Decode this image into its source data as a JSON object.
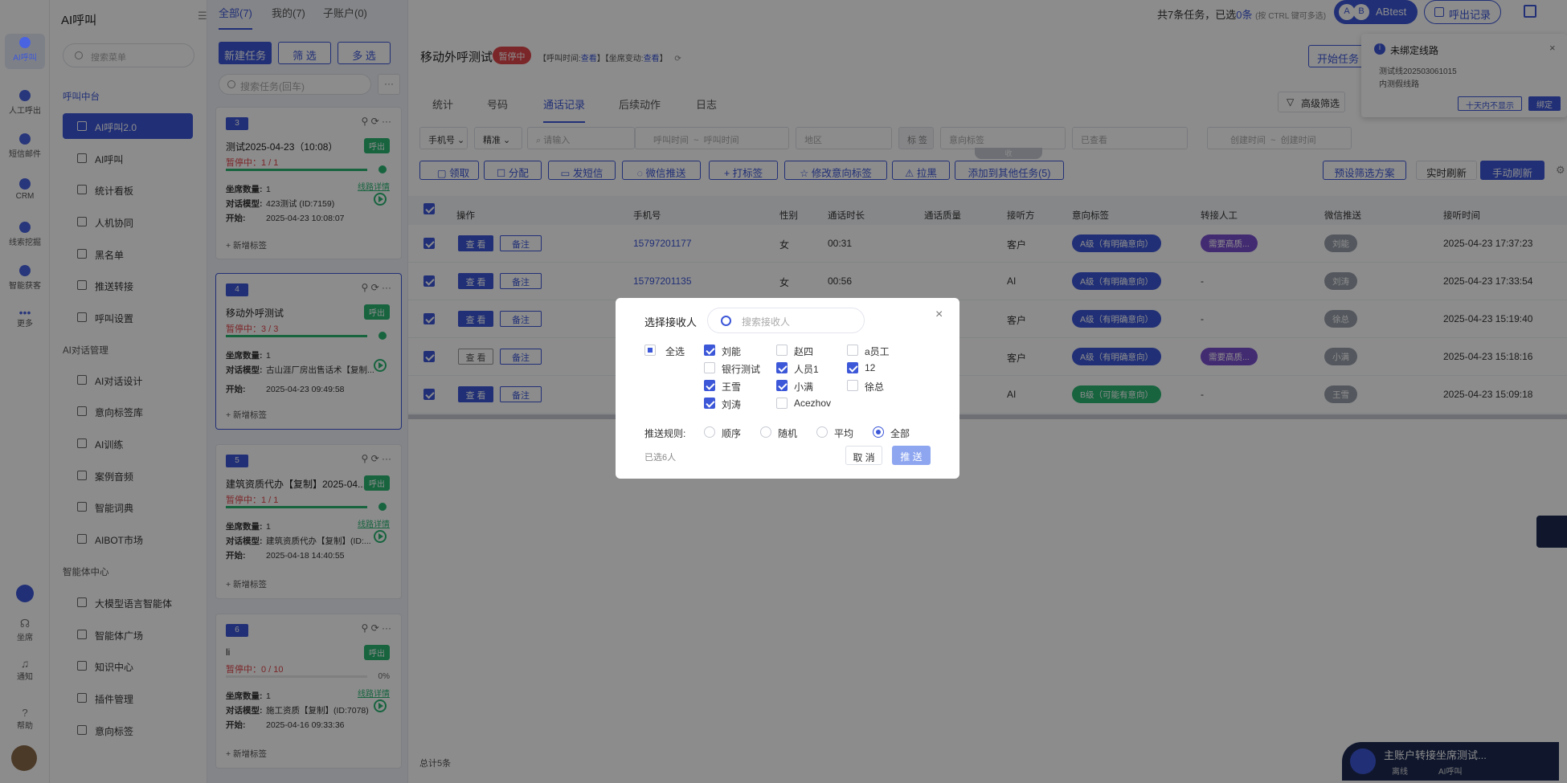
{
  "rail": {
    "items": [
      "AI呼叫",
      "人工呼出",
      "短信邮件",
      "CRM",
      "线索挖掘",
      "智能获客",
      "更多"
    ],
    "bottom": [
      "坐席",
      "通知",
      "帮助"
    ]
  },
  "menu": {
    "title": "AI呼叫",
    "search_placeholder": "搜索菜单",
    "sections": [
      {
        "title": "呼叫中台",
        "items": [
          "AI呼叫2.0",
          "AI呼叫",
          "统计看板",
          "人机协同",
          "黑名单",
          "推送转接",
          "呼叫设置"
        ]
      },
      {
        "title": "AI对话管理",
        "items": [
          "AI对话设计",
          "意向标签库",
          "AI训练",
          "案例音频",
          "智能词典",
          "AIBOT市场"
        ]
      },
      {
        "title": "智能体中心",
        "items": [
          "大模型语言智能体",
          "智能体广场",
          "知识中心",
          "插件管理",
          "意向标签"
        ]
      }
    ]
  },
  "top_tabs": [
    "全部(7)",
    "我的(7)",
    "子账户(0)"
  ],
  "top_right": {
    "summary_prefix": "共7条任务，已选",
    "summary_count": "0条",
    "summary_hint": "(按 CTRL 键可多选)",
    "avatar_a": "A",
    "avatar_b": "B",
    "user": "ABtest",
    "export": "呼出记录"
  },
  "task_list": {
    "new_task": "新建任务",
    "filter": "筛 选",
    "multi": "多 选",
    "search_placeholder": "搜索任务(回车)",
    "add_tag": "+ 新增标签",
    "route_detail": "线路详情",
    "labels": {
      "seats": "坐席数量:",
      "model": "对话模型:",
      "start": "开始:"
    },
    "cards": [
      {
        "num": "3",
        "name": "测试2025-04-23（10:08）",
        "badge": "呼出",
        "status": "暂停中：1 / 1",
        "progress": 100,
        "seats": "1",
        "model": "423测试 (ID:7159)",
        "start": "2025-04-23 10:08:07"
      },
      {
        "num": "4",
        "name": "移动外呼测试",
        "badge": "呼出",
        "status": "暂停中：3 / 3",
        "progress": 100,
        "seats": "1",
        "model": "古山涯厂房出售话术【复制...",
        "start": "2025-04-23 09:49:58"
      },
      {
        "num": "5",
        "name": "建筑资质代办【复制】2025-04...",
        "badge": "呼出",
        "status": "暂停中：1 / 1",
        "progress": 100,
        "seats": "1",
        "model": "建筑资质代办【复制】(ID:...",
        "start": "2025-04-18 14:40:55"
      },
      {
        "num": "6",
        "name": "li",
        "badge": "呼出",
        "status": "暂停中：0 / 10",
        "progress": 0,
        "pct": "0%",
        "seats": "1",
        "model": "施工资质【复制】(ID:7078)",
        "start": "2025-04-16 09:33:36"
      }
    ]
  },
  "detail": {
    "title": "移动外呼测试",
    "status": "暂停中",
    "call_time_label": "【呼叫时间:",
    "call_time_link": "查看",
    "seat_label": "】【坐席变动:",
    "seat_link": "查看",
    "seat_end": "】",
    "start_btn": "开始任务",
    "tabs": [
      "统计",
      "号码",
      "通话记录",
      "后续动作",
      "日志"
    ],
    "advanced_filter": "高级筛选",
    "filters": {
      "phone_type": "手机号",
      "match": "精准",
      "input_placeholder": "请输入",
      "call_start": "呼叫时间",
      "call_end": "呼叫时间",
      "region": "地区",
      "tag_btn": "标 签",
      "intent_placeholder": "意向标签",
      "viewed": "已查看",
      "create_start": "创建时间",
      "create_end": "创建时间"
    },
    "collapse": "收",
    "actions": [
      "领取",
      "分配",
      "发短信",
      "微信推送",
      "+ 打标签",
      "修改意向标签",
      "拉黑",
      "添加到其他任务(5)"
    ],
    "right_actions": {
      "preset": "预设筛选方案",
      "realtime": "实时刷新",
      "manual": "手动刷新"
    },
    "columns": [
      "操作",
      "手机号",
      "性别",
      "通话时长",
      "通话质量",
      "接听方",
      "意向标签",
      "转接人工",
      "微信推送",
      "接听时间"
    ],
    "view_btn": "查 看",
    "note_btn": "备注",
    "rows": [
      {
        "phone": "15797201177",
        "gender": "女",
        "duration": "00:31",
        "answer": "客户",
        "intent": "A级（有明确意向）",
        "intent_color": "#3c57d8",
        "transfer": "需要高质...",
        "wechat": "刘能",
        "time": "2025-04-23 17:37:23"
      },
      {
        "phone": "15797201135",
        "gender": "女",
        "duration": "00:56",
        "answer": "AI",
        "intent": "A级（有明确意向）",
        "intent_color": "#3c57d8",
        "transfer": "-",
        "wechat": "刘涛",
        "time": "2025-04-23 17:33:54"
      },
      {
        "phone": "",
        "gender": "",
        "duration": "",
        "answer": "客户",
        "intent": "A级（有明确意向）",
        "intent_color": "#3c57d8",
        "transfer": "-",
        "wechat": "徐总",
        "time": "2025-04-23 15:19:40"
      },
      {
        "phone": "",
        "gender": "",
        "duration": "",
        "answer": "客户",
        "intent": "A级（有明确意向）",
        "intent_color": "#3c57d8",
        "transfer": "需要高质...",
        "wechat": "小满",
        "time": "2025-04-23 15:18:16"
      },
      {
        "phone": "",
        "gender": "",
        "duration": "",
        "answer": "AI",
        "intent": "B级（可能有意向）",
        "intent_color": "#2bb673",
        "transfer": "-",
        "wechat": "王雪",
        "time": "2025-04-23 15:09:18"
      }
    ],
    "total": "总计5条"
  },
  "notice": {
    "title": "未绑定线路",
    "line1": "测试线2025030610​15",
    "line2": "内测假线路",
    "ignore": "十天内不显示",
    "bind": "绑定"
  },
  "bottom_bar": {
    "title": "主账户转接坐席测试...",
    "status1": "离线",
    "status2": "AI呼叫"
  },
  "dialog": {
    "title": "选择接收人",
    "search_placeholder": "搜索接收人",
    "select_all": "全选",
    "recipients": [
      {
        "name": "刘能",
        "checked": true
      },
      {
        "name": "赵四",
        "checked": false
      },
      {
        "name": "a员工",
        "checked": false
      },
      {
        "name": "银行测试",
        "checked": false
      },
      {
        "name": "人员1",
        "checked": true
      },
      {
        "name": "12",
        "checked": true
      },
      {
        "name": "王雪",
        "checked": true
      },
      {
        "name": "小满",
        "checked": true
      },
      {
        "name": "徐总",
        "checked": false
      },
      {
        "name": "刘涛",
        "checked": true
      },
      {
        "name": "Acezhov",
        "checked": false
      }
    ],
    "rule_label": "推送规则:",
    "rules": [
      "顺序",
      "随机",
      "平均",
      "全部"
    ],
    "rule_selected": "全部",
    "selected_count": "已选6人",
    "cancel": "取 消",
    "send": "推 送"
  }
}
